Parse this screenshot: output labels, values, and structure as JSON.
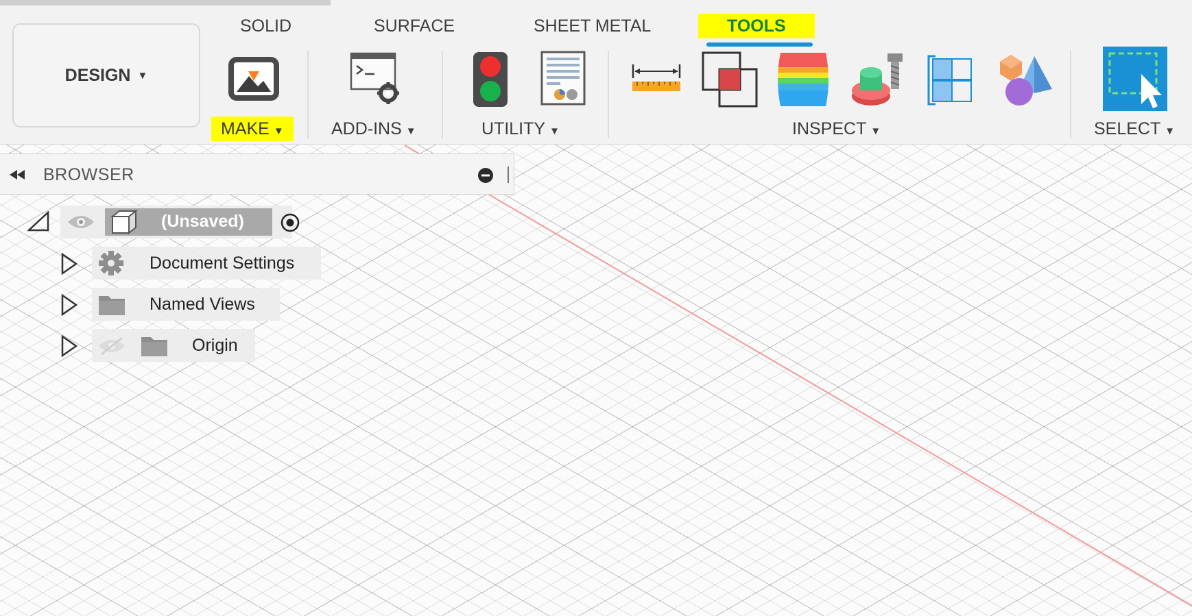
{
  "toolbar": {
    "workspace": {
      "label": "DESIGN",
      "caret": "▼"
    },
    "tabs": [
      "SOLID",
      "SURFACE",
      "SHEET METAL",
      "TOOLS"
    ],
    "active_tab": "TOOLS",
    "groups": {
      "make": {
        "label": "MAKE",
        "caret": "▼"
      },
      "add_ins": {
        "label": "ADD-INS",
        "caret": "▼"
      },
      "utility": {
        "label": "UTILITY",
        "caret": "▼"
      },
      "inspect": {
        "label": "INSPECT",
        "caret": "▼"
      },
      "select": {
        "label": "SELECT",
        "caret": "▼"
      }
    },
    "icons": [
      "3d-print-icon",
      "scripts-addins-icon",
      "traffic-light-icon",
      "table-report-icon",
      "measure-ruler-icon",
      "interference-icon",
      "zebra-analysis-icon",
      "component-color-icon",
      "section-analysis-icon",
      "display-shapes-icon",
      "window-select-icon"
    ]
  },
  "browser": {
    "title": "BROWSER",
    "root": {
      "label": "(Unsaved)"
    },
    "items": [
      {
        "label": "Document Settings",
        "icon": "gear-icon"
      },
      {
        "label": "Named Views",
        "icon": "folder-icon"
      },
      {
        "label": "Origin",
        "icon": "folder-icon"
      }
    ]
  },
  "colors": {
    "highlight": "#ffff00",
    "active_tab_text": "#16803a",
    "tab_underline": "#1a91d4",
    "select_button": "#1a91d4",
    "axis_line": "#f39a9a"
  }
}
